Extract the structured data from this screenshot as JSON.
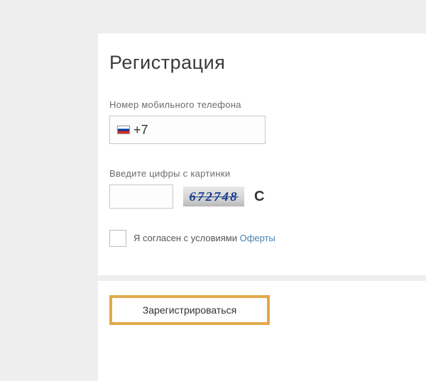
{
  "title": "Регистрация",
  "phone": {
    "label": "Номер мобильного телефона",
    "prefix": "+7",
    "flag": "ru"
  },
  "captcha": {
    "label": "Введите цифры с картинки",
    "image_text": "672748"
  },
  "terms": {
    "text": "Я согласен с условиями ",
    "link_text": "Оферты"
  },
  "register_button": "Зарегистрироваться"
}
